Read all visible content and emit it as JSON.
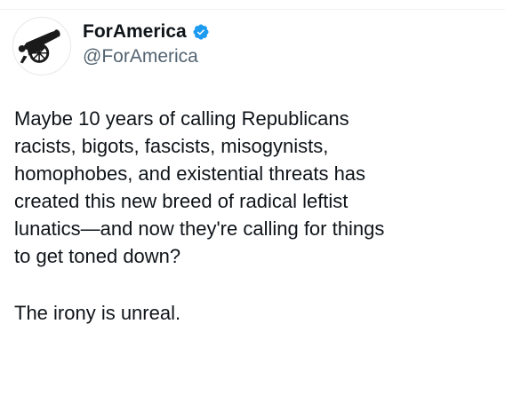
{
  "account": {
    "display_name": "ForAmerica",
    "handle": "@ForAmerica",
    "avatar_icon": "cannon-icon",
    "verified_icon": "verified-badge-icon",
    "verified_color": "#1d9bf0"
  },
  "tweet": {
    "paragraphs": [
      "Maybe 10 years of calling Republicans\nracists, bigots, fascists, misogynists,\nhomophobes, and existential threats has\ncreated this new breed of radical leftist\nlunatics—and now they're calling for things\nto get toned down?",
      "The irony is unreal."
    ]
  }
}
